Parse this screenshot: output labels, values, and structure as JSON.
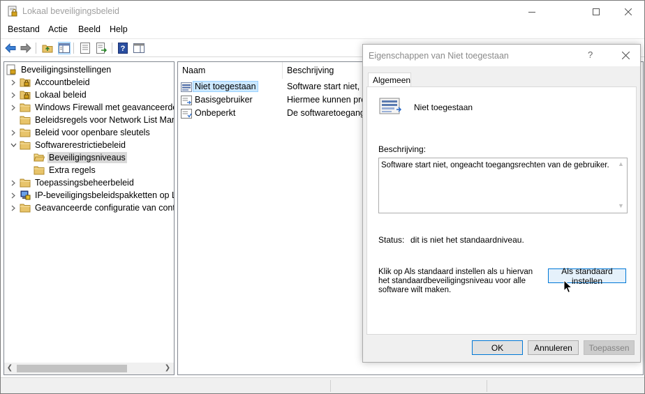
{
  "window": {
    "title": "Lokaal beveiligingsbeleid",
    "icons": {
      "app": "security-policy-app-icon",
      "minimize": "minimize-icon",
      "maximize": "maximize-icon",
      "close": "close-icon"
    }
  },
  "menu": {
    "items": [
      "Bestand",
      "Actie",
      "Beeld",
      "Help"
    ]
  },
  "toolbar": {
    "icons": [
      "back-arrow-icon",
      "forward-arrow-icon",
      "up-folder-icon",
      "show-hide-tree-icon",
      "properties-icon",
      "export-list-icon",
      "help-icon",
      "show-hide-action-pane-icon"
    ]
  },
  "tree": {
    "root": "Beveiligingsinstellingen",
    "items": [
      {
        "label": "Accountbeleid",
        "icon": "lock-folder-icon",
        "expander": "collapsed"
      },
      {
        "label": "Lokaal beleid",
        "icon": "lock-folder-icon",
        "expander": "collapsed"
      },
      {
        "label": "Windows Firewall met geavanceerde b",
        "icon": "folder-icon",
        "expander": "collapsed"
      },
      {
        "label": "Beleidsregels voor Network List Mana",
        "icon": "folder-icon",
        "expander": "none"
      },
      {
        "label": "Beleid voor openbare sleutels",
        "icon": "folder-icon",
        "expander": "collapsed"
      },
      {
        "label": "Softwarerestrictiebeleid",
        "icon": "folder-icon",
        "expander": "expanded"
      },
      {
        "label": "Beveiligingsniveaus",
        "icon": "folder-open-icon",
        "expander": "none",
        "selected": true
      },
      {
        "label": "Extra regels",
        "icon": "folder-icon",
        "expander": "none"
      },
      {
        "label": "Toepassingsbeheerbeleid",
        "icon": "folder-icon",
        "expander": "collapsed"
      },
      {
        "label": "IP-beveiligingsbeleidspakketten op Lo",
        "icon": "ipsec-policy-icon",
        "expander": "collapsed"
      },
      {
        "label": "Geavanceerde configuratie van contro",
        "icon": "folder-icon",
        "expander": "collapsed"
      }
    ]
  },
  "list": {
    "columns": [
      "Naam",
      "Beschrijving"
    ],
    "rows": [
      {
        "name": "Niet toegestaan",
        "desc": "Software start niet, o",
        "selected": true,
        "icon": "disallowed-level-icon"
      },
      {
        "name": "Basisgebruiker",
        "desc": "Hiermee kunnen pro",
        "icon": "basic-user-level-icon"
      },
      {
        "name": "Onbeperkt",
        "desc": "De softwaretoegangs",
        "icon": "unrestricted-level-icon"
      }
    ]
  },
  "dialog": {
    "title": "Eigenschappen van Niet toegestaan",
    "help": "?",
    "tab": "Algemeen",
    "level_name": "Niet toegestaan",
    "description_label": "Beschrijving:",
    "description_text": "Software start niet, ongeacht toegangsrechten van de gebruiker.",
    "status_label": "Status:",
    "status_value": "dit is niet het standaardniveau.",
    "info_text": "Klik op Als standaard instellen als u hiervan het standaardbeveiligingsniveau voor alle software wilt maken.",
    "set_default": "Als standaard instellen",
    "ok": "OK",
    "cancel": "Annuleren",
    "apply": "Toepassen"
  },
  "colors": {
    "selection_list": "#cce8ff",
    "selection_tree": "#d9d9d9",
    "accent": "#0078d7",
    "folder": "#e8c46a"
  }
}
